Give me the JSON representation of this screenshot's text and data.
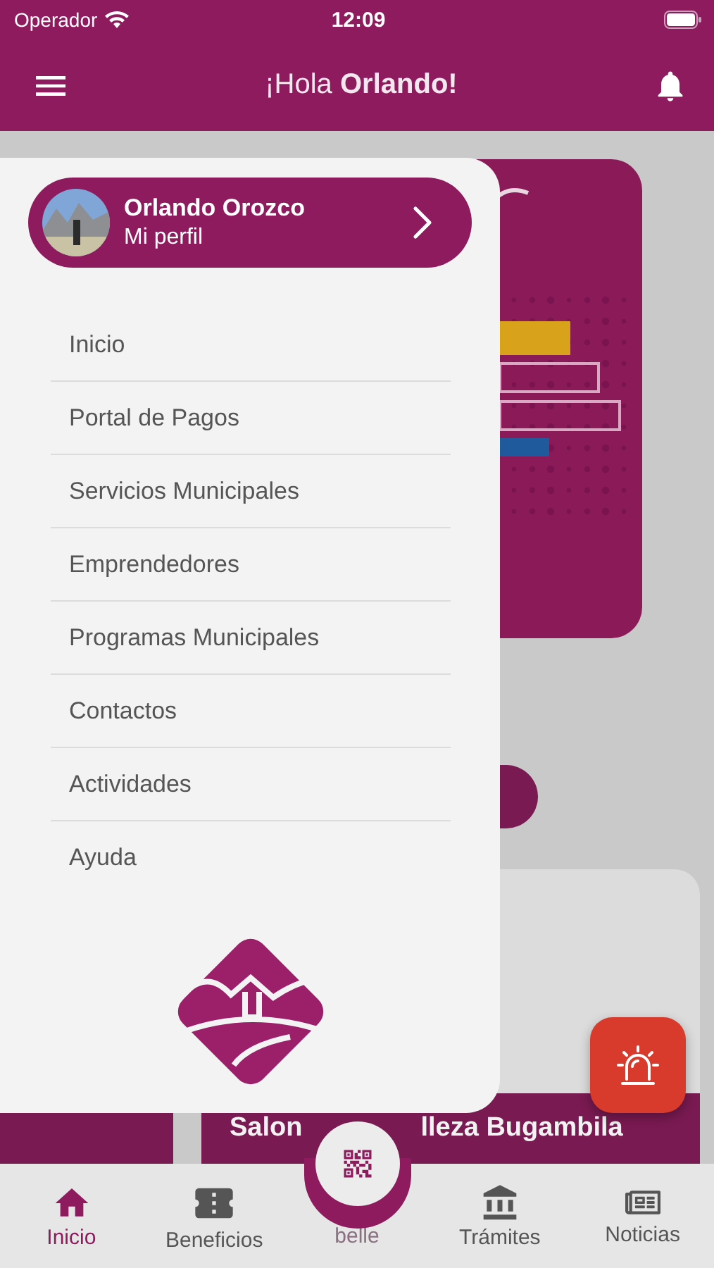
{
  "status_bar": {
    "carrier": "Operador",
    "time": "12:09"
  },
  "header": {
    "greeting": "¡Hola ",
    "name": "Orlando!"
  },
  "drawer": {
    "profile": {
      "name": "Orlando Orozco",
      "link": "Mi perfil"
    },
    "items": [
      {
        "label": "Inicio"
      },
      {
        "label": "Portal de Pagos"
      },
      {
        "label": "Servicios Municipales"
      },
      {
        "label": "Emprendedores"
      },
      {
        "label": "Programas Municipales"
      },
      {
        "label": "Contactos"
      },
      {
        "label": "Actividades"
      },
      {
        "label": "Ayuda"
      }
    ]
  },
  "card": {
    "title_start": "Salon",
    "title_end": "lleza Bugambila",
    "caption": "belle"
  },
  "bottom_nav": [
    {
      "kind": "home",
      "label": "Inicio",
      "selected": true
    },
    {
      "kind": "ticket",
      "label": "Beneficios",
      "selected": false
    },
    {
      "kind": "qr",
      "selected": false
    },
    {
      "kind": "bank",
      "label": "Trámites",
      "selected": false
    },
    {
      "kind": "news",
      "label": "Noticias",
      "selected": false
    }
  ]
}
